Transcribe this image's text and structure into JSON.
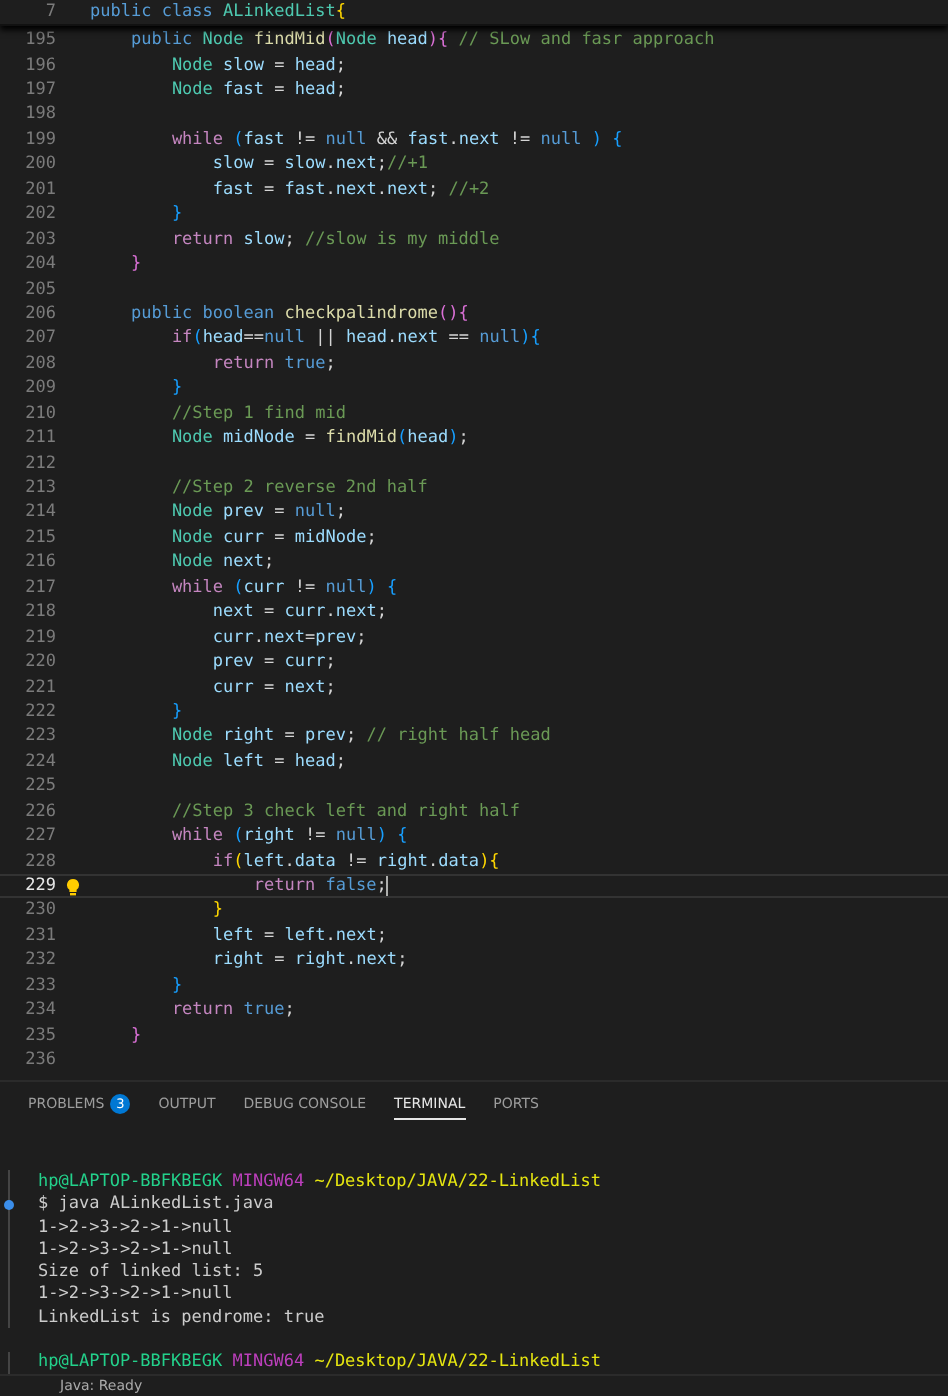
{
  "editor": {
    "sticky_line": {
      "number": "7",
      "segments": [
        {
          "kind": "keyword",
          "text": "public class "
        },
        {
          "kind": "type",
          "text": "ALinkedList"
        },
        {
          "kind": "bracket1",
          "text": "{"
        }
      ]
    },
    "lines": [
      {
        "number": "195",
        "current": false,
        "segments": [
          {
            "kind": "keyword",
            "text": "    public "
          },
          {
            "kind": "type",
            "text": "Node "
          },
          {
            "kind": "function",
            "text": "findMid"
          },
          {
            "kind": "bracket2",
            "text": "("
          },
          {
            "kind": "type",
            "text": "Node "
          },
          {
            "kind": "variable",
            "text": "head"
          },
          {
            "kind": "bracket2",
            "text": "){ "
          },
          {
            "kind": "comment",
            "text": "// SLow and fasr approach"
          }
        ]
      },
      {
        "number": "196",
        "current": false,
        "segments": [
          {
            "kind": "type",
            "text": "        Node "
          },
          {
            "kind": "variable",
            "text": "slow"
          },
          {
            "kind": "plain",
            "text": " = "
          },
          {
            "kind": "variable",
            "text": "head"
          },
          {
            "kind": "plain",
            "text": ";"
          }
        ]
      },
      {
        "number": "197",
        "current": false,
        "segments": [
          {
            "kind": "type",
            "text": "        Node "
          },
          {
            "kind": "variable",
            "text": "fast"
          },
          {
            "kind": "plain",
            "text": " = "
          },
          {
            "kind": "variable",
            "text": "head"
          },
          {
            "kind": "plain",
            "text": ";"
          }
        ]
      },
      {
        "number": "198",
        "current": false
      },
      {
        "number": "199",
        "current": false,
        "segments": [
          {
            "kind": "control",
            "text": "        while "
          },
          {
            "kind": "bracket3",
            "text": "("
          },
          {
            "kind": "variable",
            "text": "fast"
          },
          {
            "kind": "plain",
            "text": " != "
          },
          {
            "kind": "keyword",
            "text": "null"
          },
          {
            "kind": "plain",
            "text": " && "
          },
          {
            "kind": "variable",
            "text": "fast"
          },
          {
            "kind": "plain",
            "text": "."
          },
          {
            "kind": "variable",
            "text": "next"
          },
          {
            "kind": "plain",
            "text": " != "
          },
          {
            "kind": "keyword",
            "text": "null "
          },
          {
            "kind": "bracket3",
            "text": ") {"
          }
        ]
      },
      {
        "number": "200",
        "current": false,
        "segments": [
          {
            "kind": "variable",
            "text": "            slow"
          },
          {
            "kind": "plain",
            "text": " = "
          },
          {
            "kind": "variable",
            "text": "slow"
          },
          {
            "kind": "plain",
            "text": "."
          },
          {
            "kind": "variable",
            "text": "next"
          },
          {
            "kind": "plain",
            "text": ";"
          },
          {
            "kind": "comment",
            "text": "//+1"
          }
        ]
      },
      {
        "number": "201",
        "current": false,
        "segments": [
          {
            "kind": "variable",
            "text": "            fast"
          },
          {
            "kind": "plain",
            "text": " = "
          },
          {
            "kind": "variable",
            "text": "fast"
          },
          {
            "kind": "plain",
            "text": "."
          },
          {
            "kind": "variable",
            "text": "next"
          },
          {
            "kind": "plain",
            "text": "."
          },
          {
            "kind": "variable",
            "text": "next"
          },
          {
            "kind": "plain",
            "text": "; "
          },
          {
            "kind": "comment",
            "text": "//+2"
          }
        ]
      },
      {
        "number": "202",
        "current": false,
        "segments": [
          {
            "kind": "bracket3",
            "text": "        }"
          }
        ]
      },
      {
        "number": "203",
        "current": false,
        "segments": [
          {
            "kind": "control",
            "text": "        return "
          },
          {
            "kind": "variable",
            "text": "slow"
          },
          {
            "kind": "plain",
            "text": "; "
          },
          {
            "kind": "comment",
            "text": "//slow is my middle"
          }
        ]
      },
      {
        "number": "204",
        "current": false,
        "segments": [
          {
            "kind": "bracket2",
            "text": "    }"
          }
        ]
      },
      {
        "number": "205",
        "current": false
      },
      {
        "number": "206",
        "current": false,
        "segments": [
          {
            "kind": "keyword",
            "text": "    public boolean "
          },
          {
            "kind": "function",
            "text": "checkpalindrome"
          },
          {
            "kind": "bracket2",
            "text": "(){"
          }
        ]
      },
      {
        "number": "207",
        "current": false,
        "segments": [
          {
            "kind": "control",
            "text": "        if"
          },
          {
            "kind": "bracket3",
            "text": "("
          },
          {
            "kind": "variable",
            "text": "head"
          },
          {
            "kind": "plain",
            "text": "=="
          },
          {
            "kind": "keyword",
            "text": "null"
          },
          {
            "kind": "plain",
            "text": " || "
          },
          {
            "kind": "variable",
            "text": "head"
          },
          {
            "kind": "plain",
            "text": "."
          },
          {
            "kind": "variable",
            "text": "next"
          },
          {
            "kind": "plain",
            "text": " == "
          },
          {
            "kind": "keyword",
            "text": "null"
          },
          {
            "kind": "bracket3",
            "text": "){"
          }
        ]
      },
      {
        "number": "208",
        "current": false,
        "segments": [
          {
            "kind": "control",
            "text": "            return "
          },
          {
            "kind": "keyword",
            "text": "true"
          },
          {
            "kind": "plain",
            "text": ";"
          }
        ]
      },
      {
        "number": "209",
        "current": false,
        "segments": [
          {
            "kind": "bracket3",
            "text": "        }"
          }
        ]
      },
      {
        "number": "210",
        "current": false,
        "segments": [
          {
            "kind": "comment",
            "text": "        //Step 1 find mid"
          }
        ]
      },
      {
        "number": "211",
        "current": false,
        "segments": [
          {
            "kind": "type",
            "text": "        Node "
          },
          {
            "kind": "variable",
            "text": "midNode"
          },
          {
            "kind": "plain",
            "text": " = "
          },
          {
            "kind": "function",
            "text": "findMid"
          },
          {
            "kind": "bracket3",
            "text": "("
          },
          {
            "kind": "variable",
            "text": "head"
          },
          {
            "kind": "bracket3",
            "text": ")"
          },
          {
            "kind": "plain",
            "text": ";"
          }
        ]
      },
      {
        "number": "212",
        "current": false
      },
      {
        "number": "213",
        "current": false,
        "segments": [
          {
            "kind": "comment",
            "text": "        //Step 2 reverse 2nd half"
          }
        ]
      },
      {
        "number": "214",
        "current": false,
        "segments": [
          {
            "kind": "type",
            "text": "        Node "
          },
          {
            "kind": "variable",
            "text": "prev"
          },
          {
            "kind": "plain",
            "text": " = "
          },
          {
            "kind": "keyword",
            "text": "null"
          },
          {
            "kind": "plain",
            "text": ";"
          }
        ]
      },
      {
        "number": "215",
        "current": false,
        "segments": [
          {
            "kind": "type",
            "text": "        Node "
          },
          {
            "kind": "variable",
            "text": "curr"
          },
          {
            "kind": "plain",
            "text": " = "
          },
          {
            "kind": "variable",
            "text": "midNode"
          },
          {
            "kind": "plain",
            "text": ";"
          }
        ]
      },
      {
        "number": "216",
        "current": false,
        "segments": [
          {
            "kind": "type",
            "text": "        Node "
          },
          {
            "kind": "variable",
            "text": "next"
          },
          {
            "kind": "plain",
            "text": ";"
          }
        ]
      },
      {
        "number": "217",
        "current": false,
        "segments": [
          {
            "kind": "control",
            "text": "        while "
          },
          {
            "kind": "bracket3",
            "text": "("
          },
          {
            "kind": "variable",
            "text": "curr"
          },
          {
            "kind": "plain",
            "text": " != "
          },
          {
            "kind": "keyword",
            "text": "null"
          },
          {
            "kind": "bracket3",
            "text": ") {"
          }
        ]
      },
      {
        "number": "218",
        "current": false,
        "segments": [
          {
            "kind": "variable",
            "text": "            next"
          },
          {
            "kind": "plain",
            "text": " = "
          },
          {
            "kind": "variable",
            "text": "curr"
          },
          {
            "kind": "plain",
            "text": "."
          },
          {
            "kind": "variable",
            "text": "next"
          },
          {
            "kind": "plain",
            "text": ";"
          }
        ]
      },
      {
        "number": "219",
        "current": false,
        "segments": [
          {
            "kind": "variable",
            "text": "            curr"
          },
          {
            "kind": "plain",
            "text": "."
          },
          {
            "kind": "variable",
            "text": "next"
          },
          {
            "kind": "plain",
            "text": "="
          },
          {
            "kind": "variable",
            "text": "prev"
          },
          {
            "kind": "plain",
            "text": ";"
          }
        ]
      },
      {
        "number": "220",
        "current": false,
        "segments": [
          {
            "kind": "variable",
            "text": "            prev"
          },
          {
            "kind": "plain",
            "text": " = "
          },
          {
            "kind": "variable",
            "text": "curr"
          },
          {
            "kind": "plain",
            "text": ";"
          }
        ]
      },
      {
        "number": "221",
        "current": false,
        "segments": [
          {
            "kind": "variable",
            "text": "            curr"
          },
          {
            "kind": "plain",
            "text": " = "
          },
          {
            "kind": "variable",
            "text": "next"
          },
          {
            "kind": "plain",
            "text": ";"
          }
        ]
      },
      {
        "number": "222",
        "current": false,
        "segments": [
          {
            "kind": "bracket3",
            "text": "        }"
          }
        ]
      },
      {
        "number": "223",
        "current": false,
        "segments": [
          {
            "kind": "type",
            "text": "        Node "
          },
          {
            "kind": "variable",
            "text": "right"
          },
          {
            "kind": "plain",
            "text": " = "
          },
          {
            "kind": "variable",
            "text": "prev"
          },
          {
            "kind": "plain",
            "text": "; "
          },
          {
            "kind": "comment",
            "text": "// right half head"
          }
        ]
      },
      {
        "number": "224",
        "current": false,
        "segments": [
          {
            "kind": "type",
            "text": "        Node "
          },
          {
            "kind": "variable",
            "text": "left"
          },
          {
            "kind": "plain",
            "text": " = "
          },
          {
            "kind": "variable",
            "text": "head"
          },
          {
            "kind": "plain",
            "text": ";"
          }
        ]
      },
      {
        "number": "225",
        "current": false
      },
      {
        "number": "226",
        "current": false,
        "segments": [
          {
            "kind": "comment",
            "text": "        //Step 3 check left and right half"
          }
        ]
      },
      {
        "number": "227",
        "current": false,
        "segments": [
          {
            "kind": "control",
            "text": "        while "
          },
          {
            "kind": "bracket3",
            "text": "("
          },
          {
            "kind": "variable",
            "text": "right"
          },
          {
            "kind": "plain",
            "text": " != "
          },
          {
            "kind": "keyword",
            "text": "null"
          },
          {
            "kind": "bracket3",
            "text": ") {"
          }
        ]
      },
      {
        "number": "228",
        "current": false,
        "segments": [
          {
            "kind": "control",
            "text": "            if"
          },
          {
            "kind": "bracket1",
            "text": "("
          },
          {
            "kind": "variable",
            "text": "left"
          },
          {
            "kind": "plain",
            "text": "."
          },
          {
            "kind": "variable",
            "text": "data"
          },
          {
            "kind": "plain",
            "text": " != "
          },
          {
            "kind": "variable",
            "text": "right"
          },
          {
            "kind": "plain",
            "text": "."
          },
          {
            "kind": "variable",
            "text": "data"
          },
          {
            "kind": "bracket1",
            "text": "){"
          }
        ]
      },
      {
        "number": "229",
        "current": true,
        "segments": [
          {
            "kind": "control",
            "text": "                return "
          },
          {
            "kind": "keyword",
            "text": "false"
          },
          {
            "kind": "plain",
            "text": ";"
          }
        ]
      },
      {
        "number": "230",
        "current": false,
        "segments": [
          {
            "kind": "bracket1",
            "text": "            }"
          }
        ]
      },
      {
        "number": "231",
        "current": false,
        "segments": [
          {
            "kind": "variable",
            "text": "            left"
          },
          {
            "kind": "plain",
            "text": " = "
          },
          {
            "kind": "variable",
            "text": "left"
          },
          {
            "kind": "plain",
            "text": "."
          },
          {
            "kind": "variable",
            "text": "next"
          },
          {
            "kind": "plain",
            "text": ";"
          }
        ]
      },
      {
        "number": "232",
        "current": false,
        "segments": [
          {
            "kind": "variable",
            "text": "            right"
          },
          {
            "kind": "plain",
            "text": " = "
          },
          {
            "kind": "variable",
            "text": "right"
          },
          {
            "kind": "plain",
            "text": "."
          },
          {
            "kind": "variable",
            "text": "next"
          },
          {
            "kind": "plain",
            "text": ";"
          }
        ]
      },
      {
        "number": "233",
        "current": false,
        "segments": [
          {
            "kind": "bracket3",
            "text": "        }"
          }
        ]
      },
      {
        "number": "234",
        "current": false,
        "segments": [
          {
            "kind": "control",
            "text": "        return "
          },
          {
            "kind": "keyword",
            "text": "true"
          },
          {
            "kind": "plain",
            "text": ";"
          }
        ]
      },
      {
        "number": "235",
        "current": false,
        "segments": [
          {
            "kind": "bracket2",
            "text": "    }"
          }
        ]
      },
      {
        "number": "236",
        "current": false
      }
    ]
  },
  "panel": {
    "tabs": [
      {
        "label": "PROBLEMS",
        "badge": "3",
        "selected": false
      },
      {
        "label": "OUTPUT",
        "selected": false
      },
      {
        "label": "DEBUG CONSOLE",
        "selected": false
      },
      {
        "label": "TERMINAL",
        "selected": true
      },
      {
        "label": "PORTS",
        "selected": false
      }
    ],
    "terminal": [
      {
        "kind": "prompt",
        "user": "hp@LAPTOP-BBFKBEGK",
        "shell": "MINGW64",
        "path": "~/Desktop/JAVA/22-LinkedList"
      },
      {
        "kind": "command",
        "text": "$ java ALinkedList.java"
      },
      {
        "kind": "output",
        "text": "1->2->3->2->1->null"
      },
      {
        "kind": "output",
        "text": "1->2->3->2->1->null"
      },
      {
        "kind": "output",
        "text": "Size of linked list: 5"
      },
      {
        "kind": "output",
        "text": "1->2->3->2->1->null"
      },
      {
        "kind": "output",
        "text": "LinkedList is pendrome: true"
      },
      {
        "kind": "blank"
      },
      {
        "kind": "prompt",
        "user": "hp@LAPTOP-BBFKBEGK",
        "shell": "MINGW64",
        "path": "~/Desktop/JAVA/22-LinkedList"
      }
    ]
  },
  "status_bar": {
    "text": "Java: Ready"
  }
}
